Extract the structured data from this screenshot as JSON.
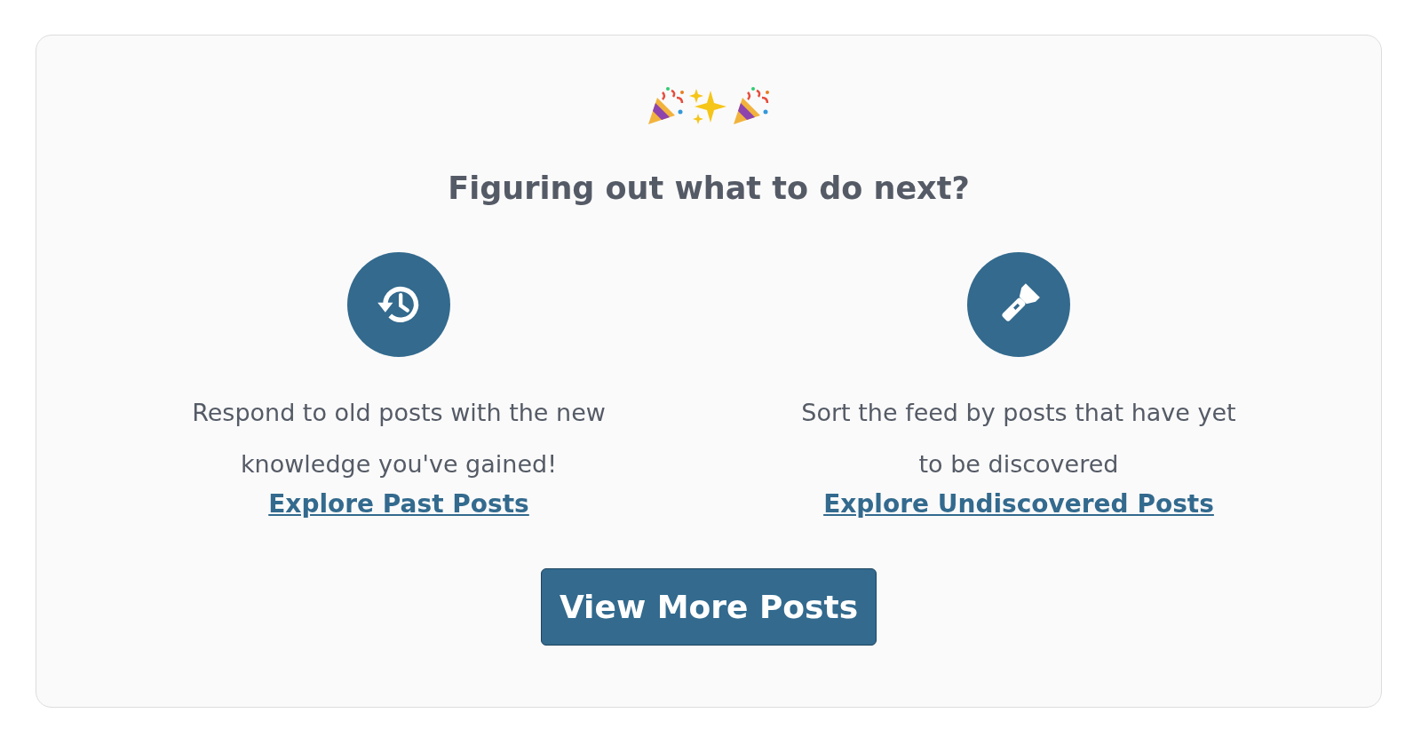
{
  "celebration": [
    {
      "kind": "party-popper"
    },
    {
      "kind": "sparkles"
    },
    {
      "kind": "party-popper"
    }
  ],
  "title": "Figuring out what to do next?",
  "options": [
    {
      "kind": "history",
      "description": "Respond to old posts with the new knowledge you've gained!",
      "link": "Explore Past Posts"
    },
    {
      "kind": "flashlight",
      "description": "Sort the feed by posts that have yet to be discovered",
      "link": "Explore Undiscovered Posts"
    }
  ],
  "button": "View More Posts"
}
